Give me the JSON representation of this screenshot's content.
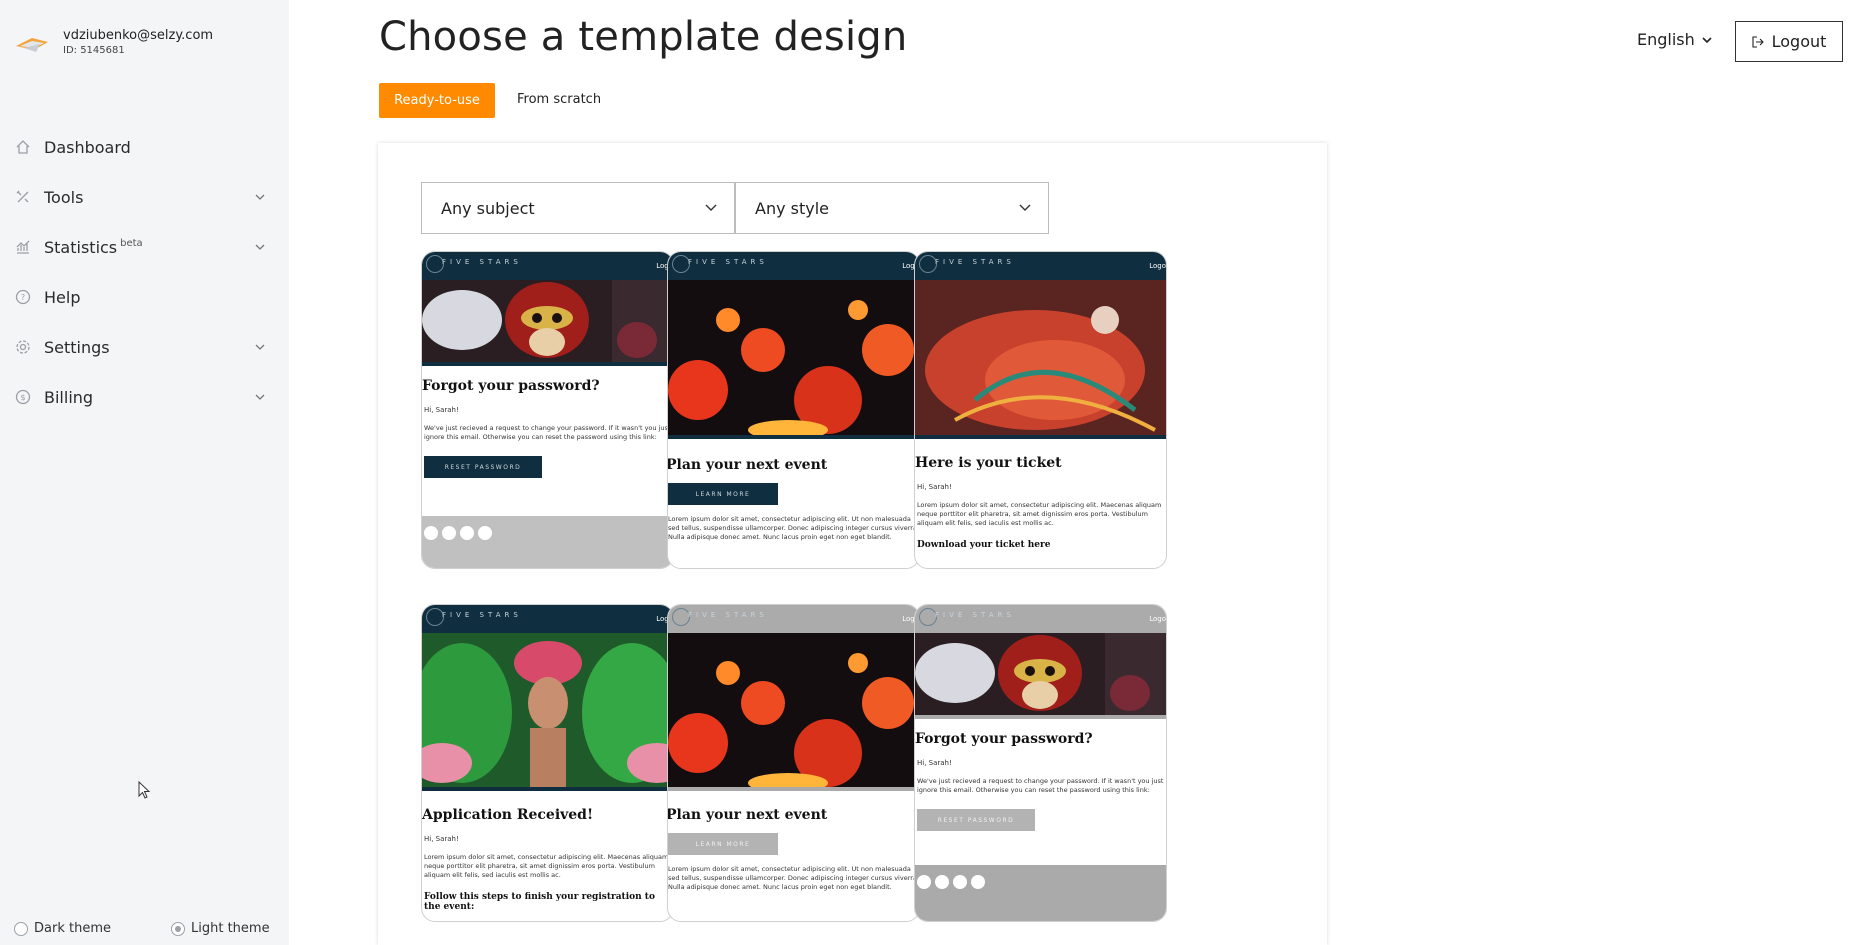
{
  "account": {
    "email": "vdziubenko@selzy.com",
    "id": "ID: 5145681"
  },
  "nav": [
    {
      "label": "Dashboard",
      "icon": "home-icon",
      "expandable": false
    },
    {
      "label": "Tools",
      "icon": "tools-icon",
      "expandable": true
    },
    {
      "label": "Statistics",
      "badge": "beta",
      "icon": "statistics-icon",
      "expandable": true
    },
    {
      "label": "Help",
      "icon": "help-icon",
      "expandable": false
    },
    {
      "label": "Settings",
      "icon": "settings-icon",
      "expandable": true
    },
    {
      "label": "Billing",
      "icon": "billing-icon",
      "expandable": true
    }
  ],
  "theme": {
    "dark_label": "Dark theme",
    "light_label": "Light theme",
    "selected": "light"
  },
  "header": {
    "title": "Choose a template design",
    "language": "English",
    "logout": "Logout"
  },
  "tabs": {
    "ready": "Ready-to-use",
    "scratch": "From scratch",
    "active": "ready"
  },
  "filters": {
    "subject": "Any subject",
    "style": "Any style"
  },
  "cards": [
    {
      "title": "Forgot your password?",
      "greeting": "Hi, Sarah!",
      "text": "We've just recieved a request to change your password. If it wasn't you just ignore this email. Otherwise you can reset the password using this link:",
      "button": "RESET PASSWORD",
      "theme": "dark",
      "image": "carnival-mask"
    },
    {
      "title": "Plan your next event",
      "button": "LEARN MORE",
      "text": "Lorem ipsum dolor sit amet, consectetur adipiscing elit. Ut non malesuada sed tellus, suspendisse ullamcorper. Donec adipiscing integer cursus viverra. Nulla adipisque donec amet. Nunc lacus proin eget non eget blandit.",
      "theme": "dark",
      "image": "lanterns"
    },
    {
      "title": "Here is your ticket",
      "greeting": "Hi, Sarah!",
      "text": "Lorem ipsum dolor sit amet, consectetur adipiscing elit. Maecenas aliquam neque porttitor elit pharetra, sit amet dignissim eros porta. Vestibulum aliquam elit felis, sed iaculis est mollis ac.",
      "link": "Download your ticket here",
      "theme": "dark",
      "image": "dancer"
    },
    {
      "title": "Application Received!",
      "greeting": "Hi, Sarah!",
      "text": "Lorem ipsum dolor sit amet, consectetur adipiscing elit. Maecenas aliquam neque porttitor elit pharetra, sit amet dignissim eros porta. Vestibulum aliquam elit felis, sed iaculis est mollis ac.",
      "link": "Follow this steps to finish your registration to the event:",
      "theme": "dark",
      "image": "feathers"
    },
    {
      "title": "Plan your next event",
      "button": "LEARN MORE",
      "text": "Lorem ipsum dolor sit amet, consectetur adipiscing elit. Ut non malesuada sed tellus, suspendisse ullamcorper. Donec adipiscing integer cursus viverra. Nulla adipisque donec amet. Nunc lacus proin eget non eget blandit.",
      "theme": "grey",
      "image": "lanterns"
    },
    {
      "title": "Forgot your password?",
      "greeting": "Hi, Sarah!",
      "text": "We've just recieved a request to change your password. If it wasn't you just ignore this email. Otherwise you can reset the password using this link:",
      "button": "RESET PASSWORD",
      "theme": "grey",
      "image": "carnival-mask"
    }
  ],
  "card_header": {
    "brand": "FIVE STARS",
    "login": "Logo"
  },
  "colors": {
    "accent": "#ff8a00",
    "card_dark": "#0f2f40",
    "card_grey": "#ababab",
    "sidebar_bg": "#f3f5f7"
  }
}
